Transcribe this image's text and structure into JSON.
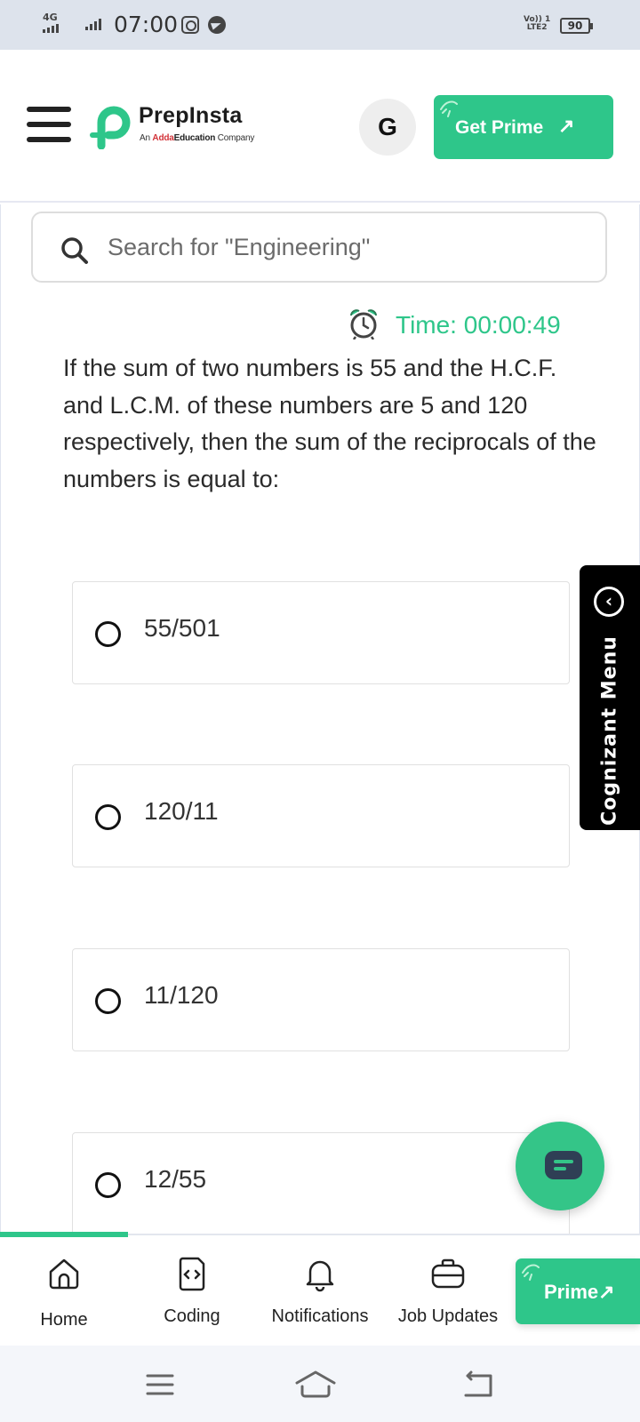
{
  "status_bar": {
    "network": "4G",
    "time": "07:00",
    "volte": [
      "Vo)) 1",
      "LTE2"
    ],
    "battery": "90"
  },
  "header": {
    "brand": "PrepInsta",
    "brand_sub": {
      "prefix": "An ",
      "highlight": "Adda",
      "mid": "Education",
      "suffix": " Company"
    },
    "avatar_letter": "G",
    "get_prime_label": "Get Prime",
    "get_prime_arrow": "↗",
    "accent_color": "#2ec68a"
  },
  "search": {
    "placeholder": "Search for \"Engineering\"",
    "value": ""
  },
  "quiz": {
    "timer": "Time: 00:00:49",
    "question": "If the sum of two numbers is 55 and the H.C.F. and L.C.M. of these numbers are 5 and 120 respectively, then the sum of the reciprocals of the numbers is equal to:",
    "options": [
      "55/501",
      "120/11",
      "11/120",
      "12/55"
    ]
  },
  "side_tab": {
    "label": "Cognizant Menu",
    "chevron": "‹"
  },
  "bottom_nav": {
    "items": [
      {
        "label": "Home",
        "icon": "home-icon"
      },
      {
        "label": "Coding",
        "icon": "code-file-icon"
      },
      {
        "label": "Notifications",
        "icon": "bell-icon"
      },
      {
        "label": "Job Updates",
        "icon": "briefcase-icon"
      }
    ],
    "prime_label": "Prime",
    "prime_arrow": "↗"
  }
}
